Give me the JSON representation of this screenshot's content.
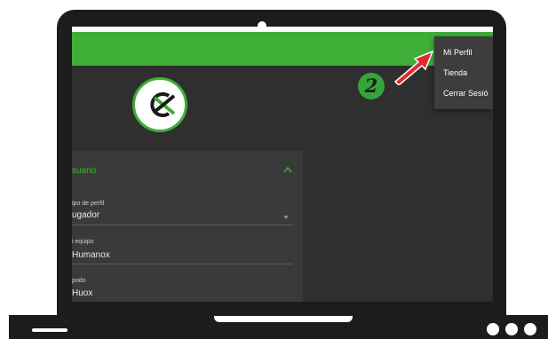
{
  "menu": {
    "items": [
      "Mi Perfil",
      "Tienda",
      "Cerrar Sesió"
    ]
  },
  "annotation": {
    "step_number": "2"
  },
  "panel": {
    "section_title": "suario",
    "fields": [
      {
        "label": "ipo de perfil",
        "value": "ugador"
      },
      {
        "label": "i equipo",
        "value": "Humanox"
      },
      {
        "label": "podo",
        "value": "Huox"
      }
    ]
  },
  "colors": {
    "brand_green": "#3fae36",
    "screen_bg": "#2f2f2f",
    "panel_bg": "#3a3a3a",
    "arrow_red": "#e12b2b"
  },
  "icons": {
    "logo": "oxygen-x-logo",
    "collapse": "chevron-up-icon",
    "dropdown": "caret-down-icon",
    "pointer": "red-arrow"
  }
}
